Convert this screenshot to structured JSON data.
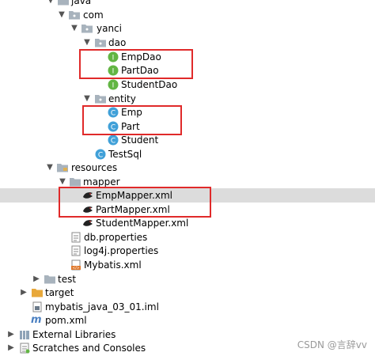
{
  "tree": {
    "java": "java",
    "com": "com",
    "yanci": "yanci",
    "dao": "dao",
    "empdao": "EmpDao",
    "partdao": "PartDao",
    "studentdao": "StudentDao",
    "entity": "entity",
    "emp": "Emp",
    "part": "Part",
    "student": "Student",
    "testsql": "TestSql",
    "resources": "resources",
    "mapper": "mapper",
    "empmapper": "EmpMapper.xml",
    "partmapper": "PartMapper.xml",
    "studentmapper": "StudentMapper.xml",
    "db": "db.properties",
    "log4j": "log4j.properties",
    "mybatis": "Mybatis.xml",
    "test": "test",
    "target": "target",
    "iml": "mybatis_java_03_01.iml",
    "pom": "pom.xml",
    "extlibs": "External Libraries",
    "scratches": "Scratches and Consoles"
  },
  "watermark": "CSDN @言辞vv",
  "colors": {
    "interface": "#62b543",
    "class": "#40a0d8",
    "folder": "#a8b3bd",
    "highlight": "#e02a2a",
    "selection": "#dcdcdc"
  }
}
